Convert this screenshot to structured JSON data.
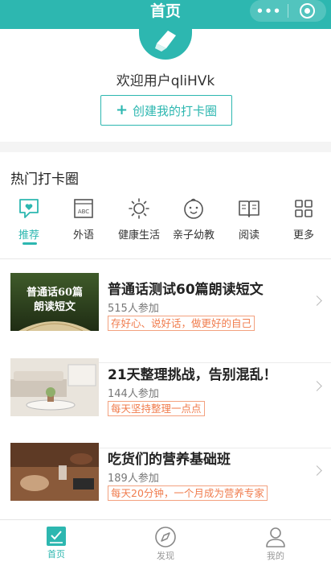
{
  "nav": {
    "title": "首页",
    "more_glyph": "•••",
    "close_icon": "target-circle-icon",
    "color": "#2db7b0"
  },
  "profile": {
    "welcome": "欢迎用户qliHVk",
    "create_button": "创建我的打卡圈",
    "create_icon": "plus-icon"
  },
  "hot": {
    "title": "热门打卡圈",
    "categories": [
      {
        "label": "推荐",
        "icon": "chat-heart-icon",
        "active": true
      },
      {
        "label": "外语",
        "icon": "abc-icon"
      },
      {
        "label": "健康生活",
        "icon": "sun-icon"
      },
      {
        "label": "亲子幼教",
        "icon": "baby-face-icon"
      },
      {
        "label": "阅读",
        "icon": "open-book-icon"
      },
      {
        "label": "更多",
        "icon": "grid-icon"
      }
    ],
    "items": [
      {
        "title": "普通话测试60篇朗读短文",
        "count": "515人参加",
        "tag": "存好心、说好话，做更好的自己",
        "thumb_text_1": "普通话60篇",
        "thumb_text_2": "朗读短文"
      },
      {
        "title": "21天整理挑战，告别混乱！",
        "count": "144人参加",
        "tag": "每天坚持整理一点点"
      },
      {
        "title": "吃货们的营养基础班",
        "count": "189人参加",
        "tag": "每天20分钟，一个月成为营养专家"
      }
    ]
  },
  "tabbar": [
    {
      "label": "首页",
      "icon": "home-check-icon",
      "active": true
    },
    {
      "label": "发现",
      "icon": "compass-icon"
    },
    {
      "label": "我的",
      "icon": "user-icon"
    }
  ],
  "colors": {
    "accent": "#2db7b0",
    "tag": "#f07c4d"
  }
}
